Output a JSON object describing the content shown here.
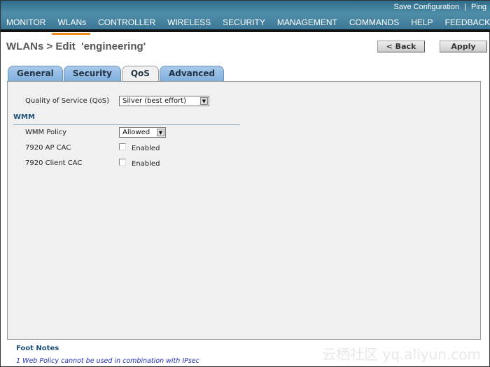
{
  "header": {
    "links": [
      "Save Configuration",
      "Ping"
    ],
    "nav": [
      "MONITOR",
      "WLANs",
      "CONTROLLER",
      "WIRELESS",
      "SECURITY",
      "MANAGEMENT",
      "COMMANDS",
      "HELP",
      "FEEDBACK"
    ],
    "active_nav": "WLANs",
    "accent": "#f08c1e"
  },
  "page": {
    "title": "WLANs > Edit  'engineering'",
    "back_label": "< Back",
    "apply_label": "Apply"
  },
  "tabs": [
    "General",
    "Security",
    "QoS",
    "Advanced"
  ],
  "active_tab": "QoS",
  "qos": {
    "label": "Quality of Service (QoS)",
    "value": "Silver (best effort)"
  },
  "wmm": {
    "heading": "WMM",
    "policy_label": "WMM Policy",
    "policy_value": "Allowed",
    "ap_cac_label": "7920 AP CAC",
    "ap_cac_checked": false,
    "ap_cac_text": "Enabled",
    "client_cac_label": "7920 Client CAC",
    "client_cac_checked": false,
    "client_cac_text": "Enabled"
  },
  "footnotes": {
    "heading": "Foot Notes",
    "items": [
      "1 Web Policy cannot be used in combination with IPsec"
    ]
  },
  "watermark": "云栖社区 yq.aliyun.com"
}
